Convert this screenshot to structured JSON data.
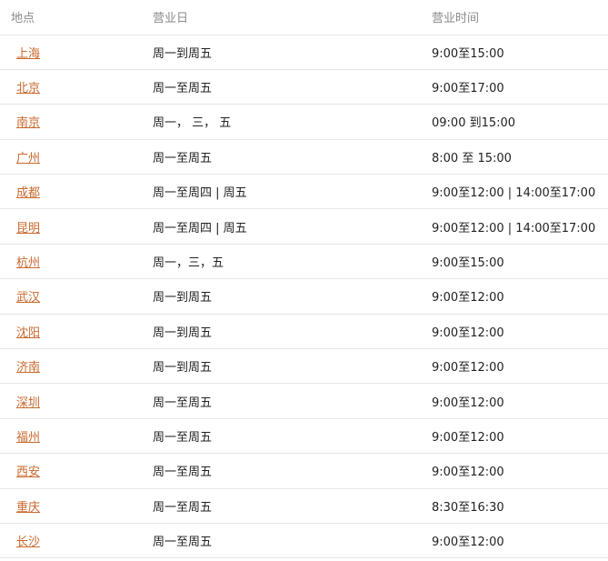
{
  "header": {
    "location": "地点",
    "days": "营业日",
    "hours": "营业时间"
  },
  "colors": {
    "link": "#c8692e",
    "header_text": "#8a8a8a",
    "border": "#e6e6e6"
  },
  "rows": [
    {
      "city": "上海",
      "days": "周一到周五",
      "hours": "9:00至15:00"
    },
    {
      "city": "北京",
      "days": "周一至周五",
      "hours": "9:00至17:00"
    },
    {
      "city": "南京",
      "days": "周一， 三， 五",
      "hours": "09:00 到15:00"
    },
    {
      "city": "广州",
      "days": "周一至周五",
      "hours": "8:00 至 15:00"
    },
    {
      "city": "成都",
      "days": "周一至周四 | 周五",
      "hours": "9:00至12:00 | 14:00至17:00"
    },
    {
      "city": "昆明",
      "days": "周一至周四 | 周五",
      "hours": "9:00至12:00 | 14:00至17:00"
    },
    {
      "city": "杭州",
      "days": "周一，三，五",
      "hours": "9:00至15:00"
    },
    {
      "city": "武汉",
      "days": "周一到周五",
      "hours": "9:00至12:00"
    },
    {
      "city": "沈阳",
      "days": "周一到周五",
      "hours": "9:00至12:00"
    },
    {
      "city": "济南",
      "days": "周一到周五",
      "hours": "9:00至12:00"
    },
    {
      "city": "深圳",
      "days": "周一至周五",
      "hours": "9:00至12:00"
    },
    {
      "city": "福州",
      "days": "周一至周五",
      "hours": "9:00至12:00"
    },
    {
      "city": "西安",
      "days": "周一至周五",
      "hours": "9:00至12:00"
    },
    {
      "city": "重庆",
      "days": "周一至周五",
      "hours": "8:30至16:30"
    },
    {
      "city": "长沙",
      "days": "周一至周五",
      "hours": "9:00至12:00"
    }
  ]
}
